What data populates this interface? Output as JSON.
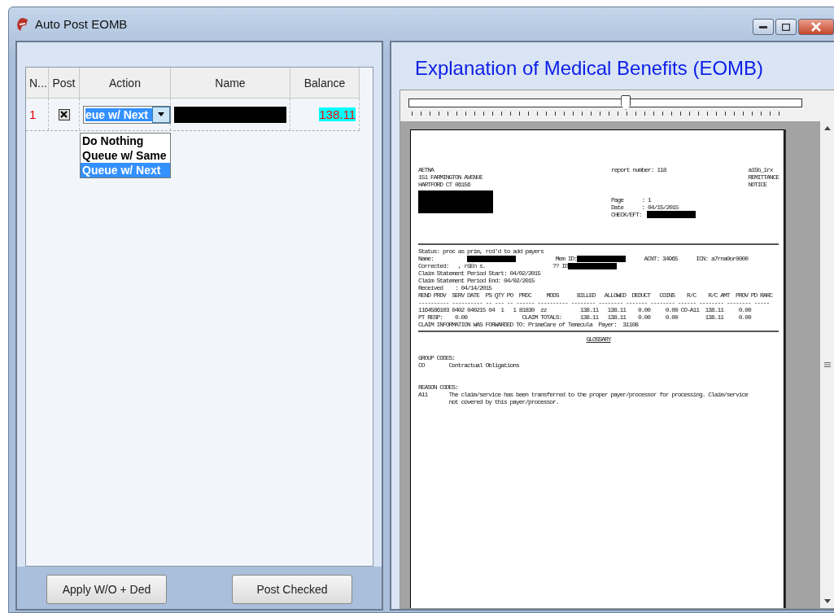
{
  "window": {
    "title": "Auto Post EOMB"
  },
  "grid": {
    "columns": [
      "N...",
      "Post",
      "Action",
      "Name",
      "Balance"
    ],
    "rows": [
      {
        "number": "1",
        "post_checked": true,
        "action": "eue w/ Next",
        "name_redacted": true,
        "balance": "138.11"
      }
    ]
  },
  "action_dropdown": {
    "expanded": true,
    "options": [
      {
        "label": "Do Nothing",
        "selected": false
      },
      {
        "label": "Queue w/ Same",
        "selected": false
      },
      {
        "label": "Queue w/ Next",
        "selected": true
      }
    ]
  },
  "buttons": [
    "Apply W/O + Ded",
    "Post Checked"
  ],
  "viewer": {
    "title": "Explanation of Medical Benefits (EOMB)",
    "zoom": {
      "level": 0.55
    },
    "document": {
      "payer": [
        "AETNA",
        "151 FARMINGTON AVENUE",
        "HARTFORD CT 06156"
      ],
      "payer_redacted": true,
      "report": "report number: 118",
      "notice": [
        "a15b_1rx",
        "REMITTANCE",
        "NOTICE"
      ],
      "page_info": [
        {
          "text": "Page      : 1",
          "redacted": false
        },
        {
          "text": "Date      : 04/15/2015",
          "redacted": false
        },
        {
          "text": "CHECK/EFT:",
          "redacted": true
        }
      ],
      "claim_lines": [
        [
          {
            "kind": "text",
            "text": "Status: proc as prim, rcd'd to add payers"
          }
        ],
        [
          {
            "kind": "text",
            "text": "Name:           "
          },
          {
            "kind": "redaction"
          },
          {
            "kind": "text",
            "text": "             Mem ID:"
          },
          {
            "kind": "redaction"
          },
          {
            "kind": "text",
            "text": "      ACNT: 34965      ICN: a7rna0or0000"
          }
        ],
        [
          {
            "kind": "text",
            "text": "Corrected:   , rGEn s.                      ?? ID"
          },
          {
            "kind": "redaction"
          }
        ],
        [
          {
            "kind": "text",
            "text": "Claim Statement Period Start: 04/02/2015"
          }
        ],
        [
          {
            "kind": "text",
            "text": "Claim Statement Period End: 04/02/2015"
          }
        ],
        [
          {
            "kind": "text",
            "text": "Received    : 04/14/2015"
          }
        ],
        [
          {
            "kind": "text",
            "text": "REND PROV  SERV DATE  PS QTY PO  PROC     MODS      BILLED   ALLOWED  DEDUCT   COINS    R/C    R/C AMT  PROV PD RARC"
          }
        ],
        [
          {
            "kind": "text",
            "text": "---------- ---------- -- --- -- ------ ---------- -------- -------- ------- -------- ------ -------- -------- -----"
          }
        ],
        [
          {
            "kind": "text",
            "text": "1164586103 0402 040215 04  1   1 81830  zz           138.11   138.11    0.00     0.00 CO-A11  138.11     0.00"
          }
        ],
        [
          {
            "kind": "text",
            "text": "PT RESP:    0.00                  CLAIM TOTALS:      138.11   138.11    0.00     0.00         138.11     0.00"
          }
        ],
        [
          {
            "kind": "text",
            "text": "CLAIM INFORMATION WAS FORWARDED TO: PrimeCare of Temecula  Payer:  31108"
          }
        ]
      ],
      "glossary_title": "GLOSSARY",
      "glossary": [
        {
          "heading": "GROUP CODES:",
          "lines": [
            "CO        Contractual Obligations"
          ]
        },
        {
          "heading": "REASON CODES:",
          "lines": [
            "A11       The claim/service has been transferred to the proper payer/processor for processing. Claim/service",
            "          not covered by this payer/processor."
          ]
        }
      ]
    }
  }
}
